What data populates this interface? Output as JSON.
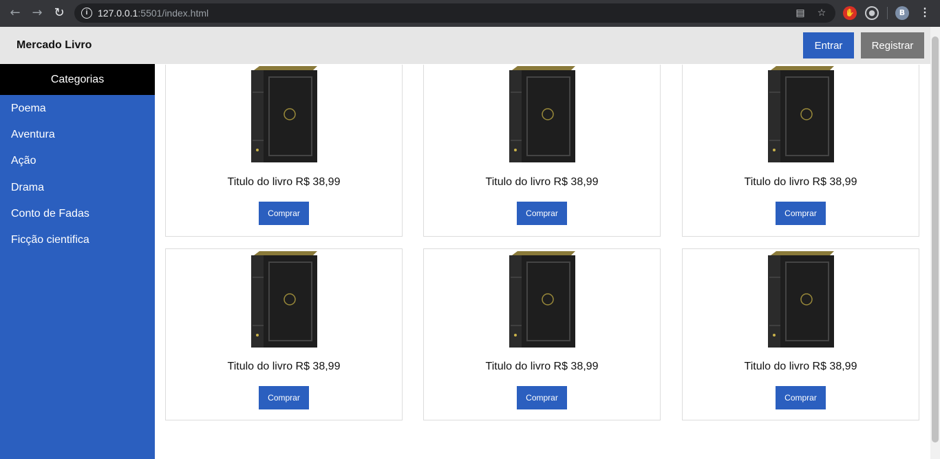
{
  "browser": {
    "back_icon": "arrow-left-icon",
    "forward_icon": "arrow-right-icon",
    "reload_icon": "reload-icon",
    "url_host": "127.0.0.1",
    "url_path": ":5501/index.html",
    "avatar_letter": "B"
  },
  "header": {
    "brand": "Mercado Livro",
    "login_label": "Entrar",
    "register_label": "Registrar"
  },
  "sidebar": {
    "title": "Categorias",
    "items": [
      {
        "label": "Poema"
      },
      {
        "label": "Aventura"
      },
      {
        "label": "Ação"
      },
      {
        "label": "Drama"
      },
      {
        "label": "Conto de Fadas"
      },
      {
        "label": "Ficção cientifica"
      }
    ]
  },
  "products": [
    {
      "title": "Titulo do livro R$ 38,99",
      "button": "Comprar"
    },
    {
      "title": "Titulo do livro R$ 38,99",
      "button": "Comprar"
    },
    {
      "title": "Titulo do livro R$ 38,99",
      "button": "Comprar"
    },
    {
      "title": "Titulo do livro R$ 38,99",
      "button": "Comprar"
    },
    {
      "title": "Titulo do livro R$ 38,99",
      "button": "Comprar"
    },
    {
      "title": "Titulo do livro R$ 38,99",
      "button": "Comprar"
    }
  ],
  "colors": {
    "primary": "#2b5fbf",
    "secondary": "#767676",
    "topbar": "#e6e6e6",
    "sidebar_head": "#000000"
  }
}
